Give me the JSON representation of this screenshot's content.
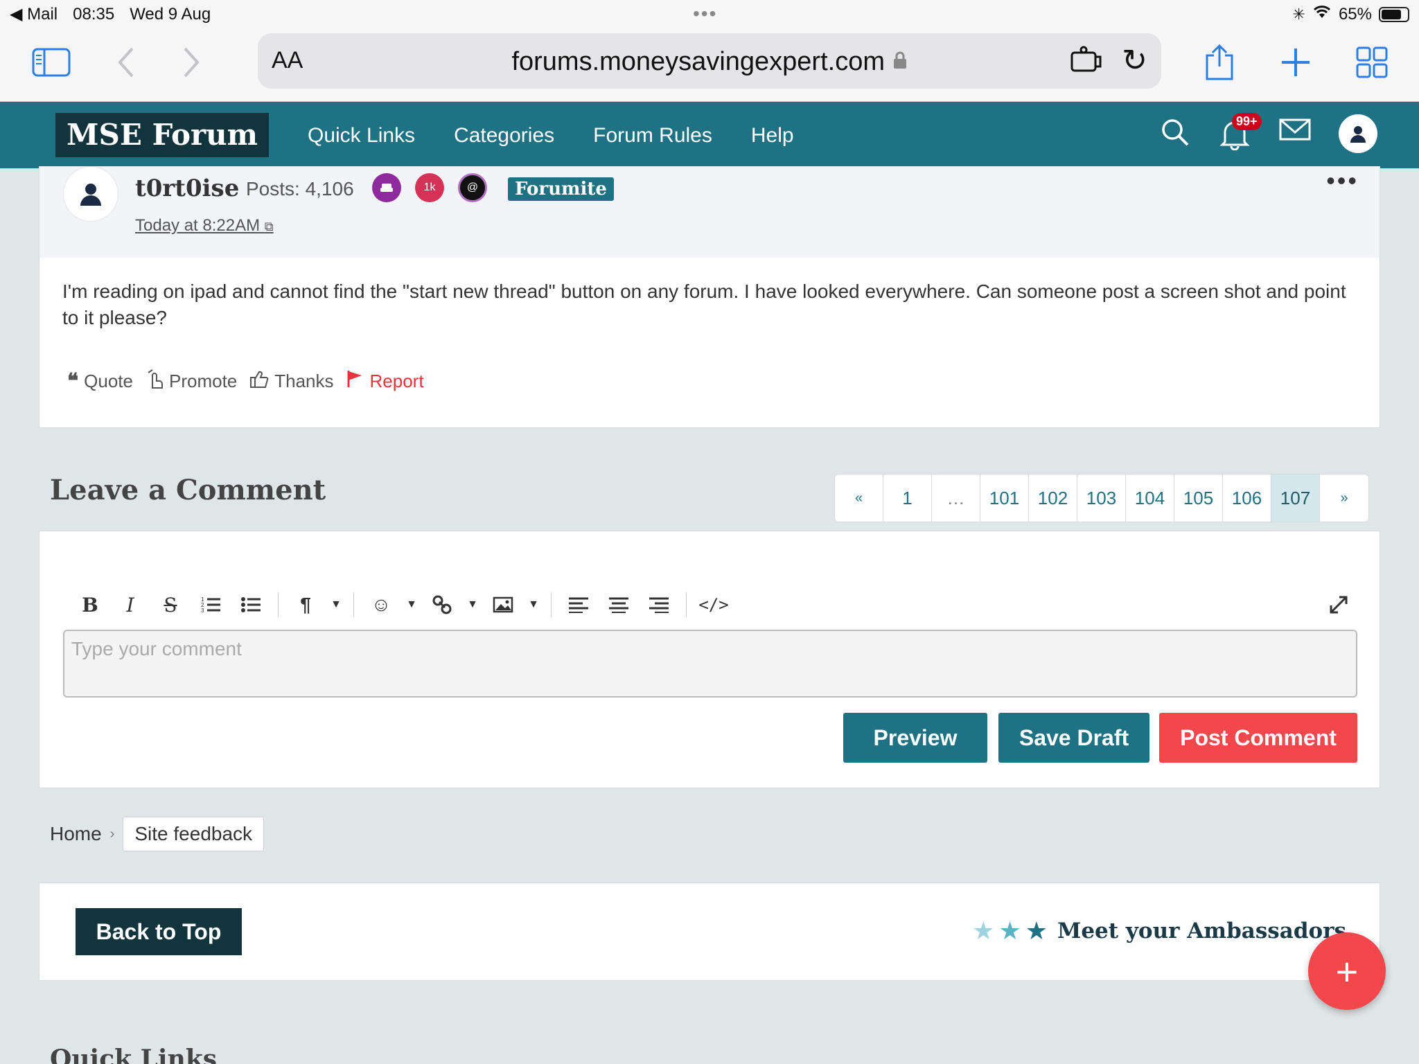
{
  "status_bar": {
    "back_app": "Mail",
    "time": "08:35",
    "date": "Wed 9 Aug",
    "battery": "65%"
  },
  "browser": {
    "aa_label": "AA",
    "url": "forums.moneysavingexpert.com"
  },
  "site_nav": {
    "logo": "MSE Forum",
    "links": [
      "Quick Links",
      "Categories",
      "Forum Rules",
      "Help"
    ],
    "notifications_badge": "99+"
  },
  "post": {
    "username": "t0rt0ise",
    "posts": "Posts: 4,106",
    "badge_1k": "1k",
    "rank": "Forumite",
    "timestamp": "Today at 8:22AM",
    "body": "I'm reading on ipad and cannot find the \"start new thread\" button on any forum. I have looked everywhere. Can someone post a screen shot and point to it please?",
    "actions": {
      "quote": "Quote",
      "promote": "Promote",
      "thanks": "Thanks",
      "report": "Report"
    }
  },
  "comment": {
    "title": "Leave a Comment",
    "placeholder": "Type your comment",
    "preview_label": "Preview",
    "save_draft_label": "Save Draft",
    "post_label": "Post Comment"
  },
  "pagination": {
    "first": "«",
    "pages": [
      "1",
      "…",
      "101",
      "102",
      "103",
      "104",
      "105",
      "106",
      "107"
    ],
    "current": "107",
    "next": "»"
  },
  "breadcrumb": {
    "home": "Home",
    "separator": "›",
    "current": "Site feedback"
  },
  "footer": {
    "back_to_top": "Back to Top",
    "ambassadors": "Meet your Ambassadors",
    "quick_links_heading": "Quick Links"
  },
  "fab": {
    "label": "+"
  },
  "colors": {
    "brand_teal": "#1e7283",
    "dark_navy": "#12343d",
    "accent_red": "#f2484c",
    "report_red": "#e8353b",
    "page_bg": "#dfe6e7"
  }
}
